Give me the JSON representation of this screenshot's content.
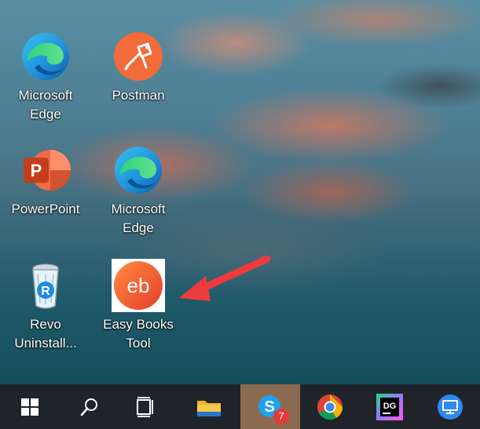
{
  "desktop": {
    "icons": [
      {
        "id": "edge1",
        "label": "Microsoft Edge",
        "line1": "Microsoft",
        "line2": "Edge",
        "icon": "edge-icon"
      },
      {
        "id": "postman",
        "label": "Postman",
        "line1": "Postman",
        "line2": "",
        "icon": "postman-icon"
      },
      {
        "id": "powerpoint",
        "label": "PowerPoint",
        "line1": "PowerPoint",
        "line2": "",
        "icon": "powerpoint-icon"
      },
      {
        "id": "edge2",
        "label": "Microsoft Edge",
        "line1": "Microsoft",
        "line2": "Edge",
        "icon": "edge-icon"
      },
      {
        "id": "revo",
        "label": "Revo Uninstall...",
        "line1": "Revo",
        "line2": "Uninstall...",
        "icon": "recycle-bin-icon"
      },
      {
        "id": "easybooks",
        "label": "Easy Books Tool",
        "line1": "Easy Books",
        "line2": "Tool",
        "icon": "easy-books-icon",
        "logo_text": "eb"
      }
    ],
    "annotation": {
      "type": "arrow",
      "color": "#ee3b3b",
      "points_to": "easybooks"
    }
  },
  "taskbar": {
    "buttons": [
      {
        "id": "start",
        "icon": "windows-start-icon"
      },
      {
        "id": "search",
        "icon": "search-icon"
      },
      {
        "id": "taskview",
        "icon": "task-view-icon"
      },
      {
        "id": "explorer",
        "icon": "folder-icon"
      },
      {
        "id": "skype",
        "icon": "skype-icon",
        "active": true,
        "badge": "7"
      },
      {
        "id": "chrome",
        "icon": "chrome-icon"
      },
      {
        "id": "datagrip",
        "icon": "datagrip-icon",
        "logo_text": "DG"
      },
      {
        "id": "remote",
        "icon": "remote-desktop-icon"
      }
    ]
  },
  "colors": {
    "taskbar_bg": "#1f242a",
    "taskbar_active": "#8c6a4f",
    "badge_red": "#e53935",
    "arrow_red": "#ee3b3b"
  }
}
